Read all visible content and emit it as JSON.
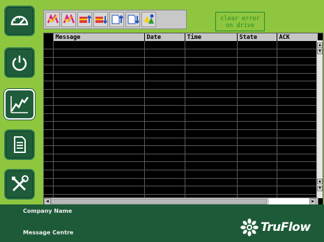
{
  "sidebar": {
    "items": [
      {
        "name": "dashboard",
        "icon": "gauge-icon"
      },
      {
        "name": "power",
        "icon": "power-icon"
      },
      {
        "name": "trends",
        "icon": "trend-chart-icon",
        "selected": true
      },
      {
        "name": "reports",
        "icon": "document-icon"
      },
      {
        "name": "settings",
        "icon": "tools-icon"
      }
    ]
  },
  "toolbar": {
    "buttons": [
      {
        "name": "acknowledge-icon"
      },
      {
        "name": "acknowledge-all-icon"
      },
      {
        "name": "sort-ascending-icon"
      },
      {
        "name": "sort-descending-icon"
      },
      {
        "name": "page-up-icon"
      },
      {
        "name": "page-down-icon"
      },
      {
        "name": "filter-icon"
      }
    ],
    "clear_error_line1": "clear error",
    "clear_error_line2": "on drive"
  },
  "grid": {
    "columns": [
      "Message",
      "Date",
      "Time",
      "State",
      "ACK"
    ],
    "rows": 23
  },
  "footer": {
    "company": "Company Name",
    "page": "Message Centre",
    "brand": "TruFlow"
  },
  "colors": {
    "background": "#8ec63f",
    "dark_green": "#1d5a38",
    "grid_bg": "#000000",
    "header_bg": "#c6c6c6"
  }
}
